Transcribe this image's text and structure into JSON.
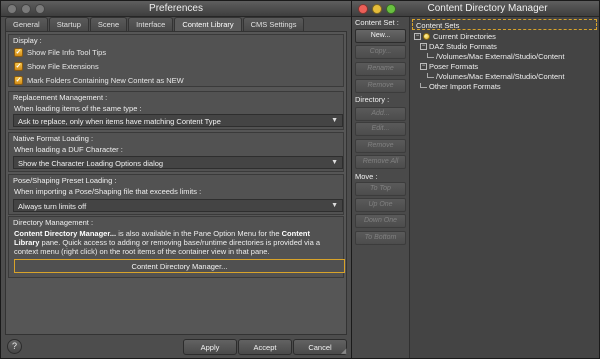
{
  "colors": {
    "traffic_red": "#ec5f58",
    "traffic_yellow": "#e5bd3a",
    "traffic_green": "#69c040",
    "traffic_inactive": "#7a7a7a",
    "focus_orange": "#d8a32a"
  },
  "preferences": {
    "title": "Preferences",
    "tabs": [
      {
        "label": "General"
      },
      {
        "label": "Startup"
      },
      {
        "label": "Scene"
      },
      {
        "label": "Interface"
      },
      {
        "label": "Content Library"
      },
      {
        "label": "CMS Settings"
      }
    ],
    "active_tab": "Content Library",
    "display": {
      "title": "Display :",
      "checkboxes": [
        {
          "label": "Show File Info Tool Tips",
          "checked": true
        },
        {
          "label": "Show File Extensions",
          "checked": true
        },
        {
          "label": "Mark Folders Containing New Content as NEW",
          "checked": true
        }
      ]
    },
    "replacement": {
      "title": "Replacement Management :",
      "prompt": "When loading items of the same type :",
      "selected": "Ask to replace, only when items have matching Content Type"
    },
    "native_format": {
      "title": "Native Format Loading :",
      "prompt": "When loading a DUF Character :",
      "selected": "Show the Character Loading Options dialog"
    },
    "pose_shaping": {
      "title": "Pose/Shaping Preset Loading :",
      "prompt": "When importing a Pose/Shaping file that exceeds limits :",
      "selected": "Always turn limits off"
    },
    "directory": {
      "title": "Directory Management :",
      "desc_bold1": "Content Directory Manager...",
      "desc_text1": " is also available in the Pane Option Menu for the ",
      "desc_bold2": "Content",
      "desc_bold3": "Library",
      "desc_text2": " pane. Quick access to adding or removing base/runtime directories is provided via a",
      "desc_text3": "context menu (right click) on the root items of the container view in that pane.",
      "button_label": "Content Directory Manager..."
    },
    "footer": {
      "help_icon": "?",
      "apply": "Apply",
      "accept": "Accept",
      "cancel": "Cancel"
    }
  },
  "cdm": {
    "title": "Content Directory Manager",
    "content_set_label": "Content Set :",
    "content_set_buttons": [
      {
        "label": "New...",
        "enabled": true
      },
      {
        "label": "Copy...",
        "enabled": false
      },
      {
        "label": "Rename",
        "enabled": false
      },
      {
        "label": "Remove",
        "enabled": false
      }
    ],
    "directory_label": "Directory :",
    "directory_buttons": [
      {
        "label": "Add...",
        "enabled": false
      },
      {
        "label": "Edit...",
        "enabled": false
      },
      {
        "label": "Remove",
        "enabled": false
      },
      {
        "label": "Remove All",
        "enabled": false
      }
    ],
    "move_label": "Move :",
    "move_buttons": [
      {
        "label": "To Top",
        "enabled": false
      },
      {
        "label": "Up One",
        "enabled": false
      },
      {
        "label": "Down One",
        "enabled": false
      },
      {
        "label": "To Bottom",
        "enabled": false
      }
    ],
    "tree": {
      "header": "Content Sets",
      "current_directories": "Current Directories",
      "daz_formats": "DAZ Studio Formats",
      "daz_path": "/Volumes/Mac External/Studio/Content",
      "poser_formats": "Poser Formats",
      "poser_path": "/Volumes/Mac External/Studio/Content",
      "other_formats": "Other Import Formats",
      "expander": "−"
    }
  }
}
